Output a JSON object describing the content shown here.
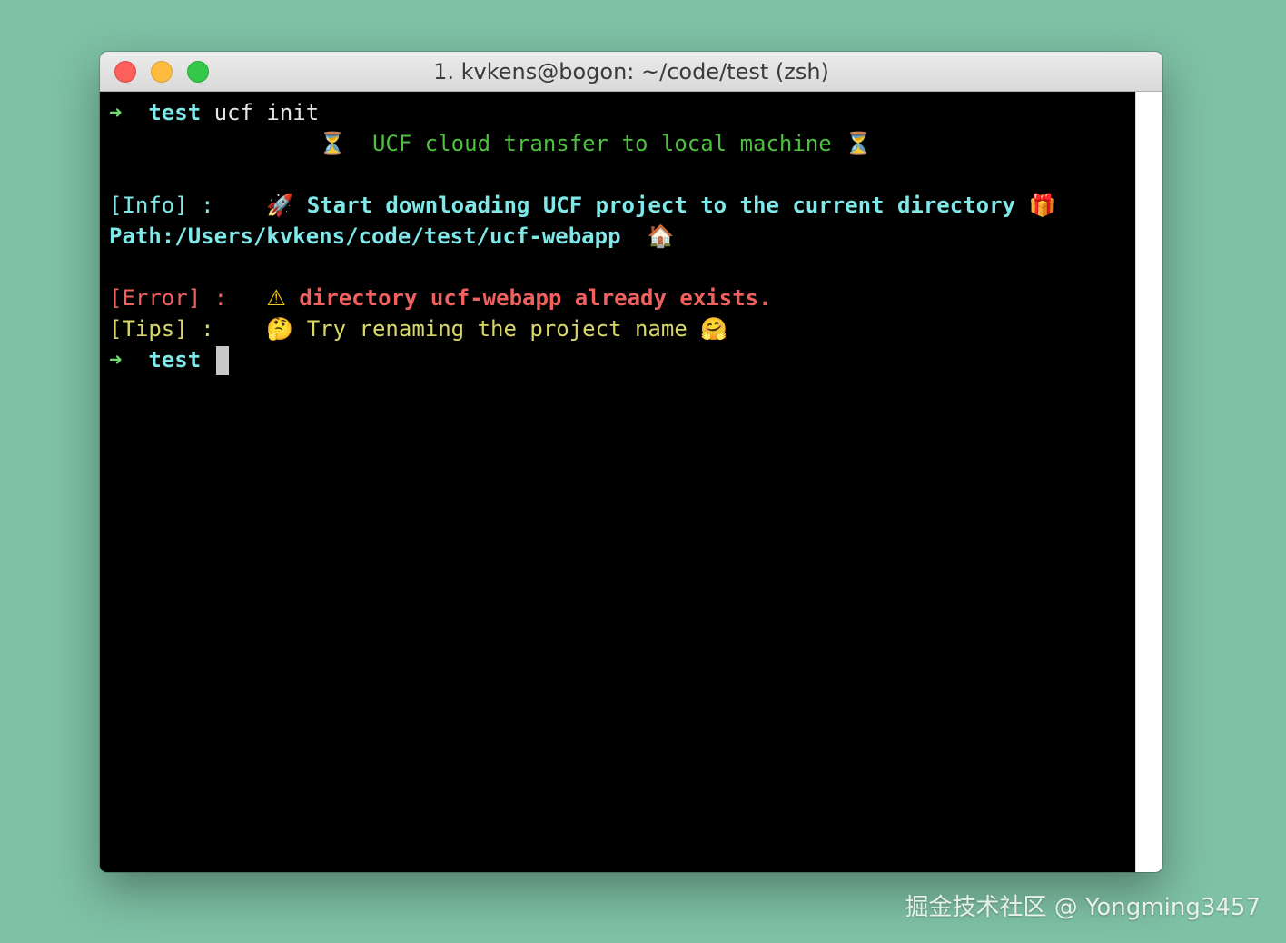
{
  "window": {
    "title": "1. kvkens@bogon: ~/code/test (zsh)"
  },
  "terminal": {
    "prompt_arrow": "➜",
    "prompt_dir": "test",
    "line1_command": "ucf init",
    "banner_icon_left": "⏳",
    "banner_text": "UCF cloud transfer to local machine",
    "banner_icon_right": "⏳",
    "info_tag": "[Info] :",
    "info_icon": "🚀",
    "info_text": "Start downloading UCF project to the current directory",
    "info_icon_end": "🎁",
    "path_text": "Path:/Users/kvkens/code/test/ucf-webapp",
    "path_icon": "🏠",
    "error_tag": "[Error] :",
    "error_icon": "⚠",
    "error_text": "directory ucf-webapp already exists.",
    "error_icon_end": "😫",
    "tips_tag": "[Tips] :",
    "tips_icon": "🤔",
    "tips_text": "Try renaming the project name",
    "tips_icon_end": "🤗"
  },
  "watermark": "掘金技术社区 @ Yongming3457",
  "colors": {
    "background": "#7ec1a5",
    "prompt_arrow": "#6fe06f",
    "prompt_dir": "#7fe8e8",
    "banner": "#4fbf3f",
    "info": "#7fe8e8",
    "error": "#f0605f",
    "tips": "#d8d86a"
  }
}
